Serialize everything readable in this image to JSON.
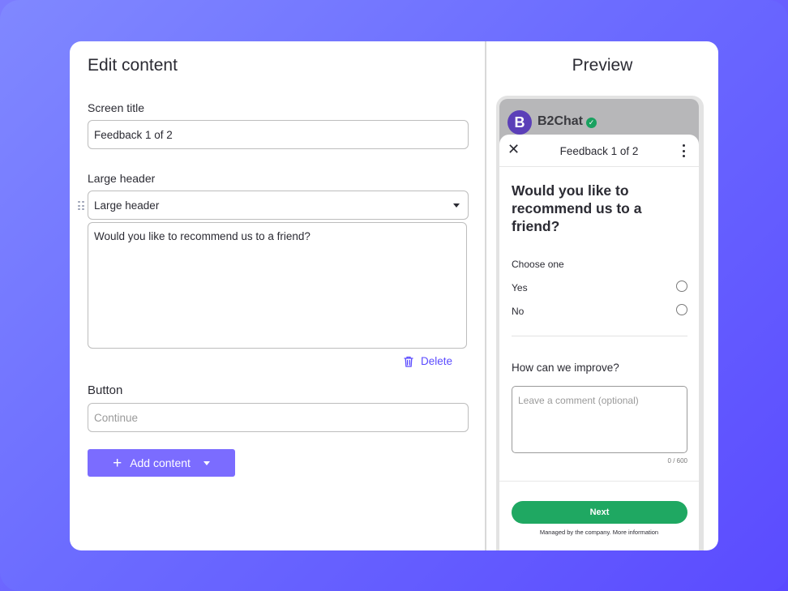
{
  "editor": {
    "title": "Edit content",
    "screen_title_label": "Screen title",
    "screen_title_value": "Feedback 1 of 2",
    "large_header_label": "Large header",
    "large_header_select": "Large header",
    "large_header_text": "Would you like to recommend us to a friend?",
    "delete_label": "Delete",
    "button_label": "Button",
    "button_placeholder": "Continue",
    "add_content_label": "Add content"
  },
  "preview": {
    "title": "Preview",
    "brand_initial": "B",
    "brand_name": "B2Chat",
    "verified_glyph": "✓",
    "sheet_title": "Feedback 1 of 2",
    "close_glyph": "✕",
    "question": "Would you like to recommend us to a friend?",
    "choose_label": "Choose one",
    "options": [
      "Yes",
      "No"
    ],
    "improve_label": "How can we improve?",
    "comment_placeholder": "Leave a comment (optional)",
    "counter": "0 / 600",
    "next_label": "Next",
    "managed_text": "Managed by the company. More information"
  },
  "colors": {
    "accent": "#5b4bff",
    "button": "#7b6cff",
    "success": "#1fa862",
    "brand": "#5b3fb8"
  }
}
